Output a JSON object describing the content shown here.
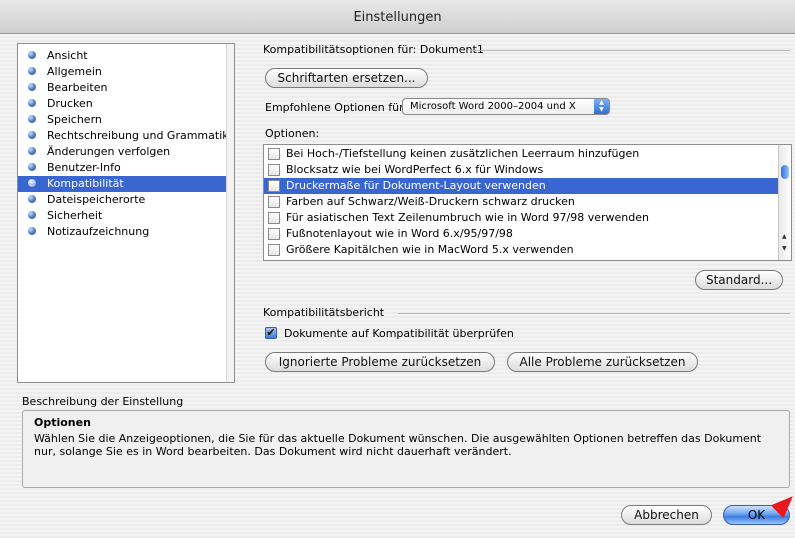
{
  "window": {
    "title": "Einstellungen"
  },
  "sidebar": {
    "items": [
      {
        "label": "Ansicht"
      },
      {
        "label": "Allgemein"
      },
      {
        "label": "Bearbeiten"
      },
      {
        "label": "Drucken"
      },
      {
        "label": "Speichern"
      },
      {
        "label": "Rechtschreibung und Grammatik"
      },
      {
        "label": "Änderungen verfolgen"
      },
      {
        "label": "Benutzer-Info"
      },
      {
        "label": "Kompatibilität",
        "selected": true
      },
      {
        "label": "Dateispeicherorte"
      },
      {
        "label": "Sicherheit"
      },
      {
        "label": "Notizaufzeichnung"
      }
    ]
  },
  "compat": {
    "section_title": "Kompatibilitätsoptionen für: Dokument1",
    "fonts_button": "Schriftarten ersetzen...",
    "recommended_label": "Empfohlene Optionen für:",
    "recommended_value": "Microsoft Word 2000–2004 und X",
    "options_label": "Optionen:",
    "options": [
      {
        "label": "Bei Hoch-/Tiefstellung keinen zusätzlichen Leerraum hinzufügen",
        "checked": false
      },
      {
        "label": "Blocksatz wie bei WordPerfect 6.x für Windows",
        "checked": false
      },
      {
        "label": "Druckermaße für Dokument-Layout verwenden",
        "checked": false,
        "selected": true
      },
      {
        "label": "Farben auf Schwarz/Weiß-Druckern schwarz drucken",
        "checked": false
      },
      {
        "label": "Für asiatischen Text Zeilenumbruch wie in Word 97/98 verwenden",
        "checked": false
      },
      {
        "label": "Fußnotenlayout wie in Word 6.x/95/97/98",
        "checked": false
      },
      {
        "label": "Größere Kapitälchen wie in MacWord 5.x verwenden",
        "checked": false
      }
    ],
    "standard_button": "Standard..."
  },
  "report": {
    "section_title": "Kompatibilitätsbericht",
    "check_label": "Dokumente auf Kompatibilität überprüfen",
    "check_checked": true,
    "reset_ignored_button": "Ignorierte Probleme zurücksetzen",
    "reset_all_button": "Alle Probleme zurücksetzen"
  },
  "description": {
    "section_title": "Beschreibung der Einstellung",
    "title": "Optionen",
    "text": "Wählen Sie die Anzeigeoptionen, die Sie für das aktuelle Dokument wünschen. Die ausgewählten Optionen betreffen das Dokument nur, solange Sie es in Word bearbeiten. Das Dokument wird nicht dauerhaft verändert."
  },
  "footer": {
    "cancel_button": "Abbrechen",
    "ok_button": "OK"
  },
  "colors": {
    "selection": "#3a66d1",
    "ok_button_blue": "#3d7ddf",
    "cursor_red": "#e8191c"
  }
}
